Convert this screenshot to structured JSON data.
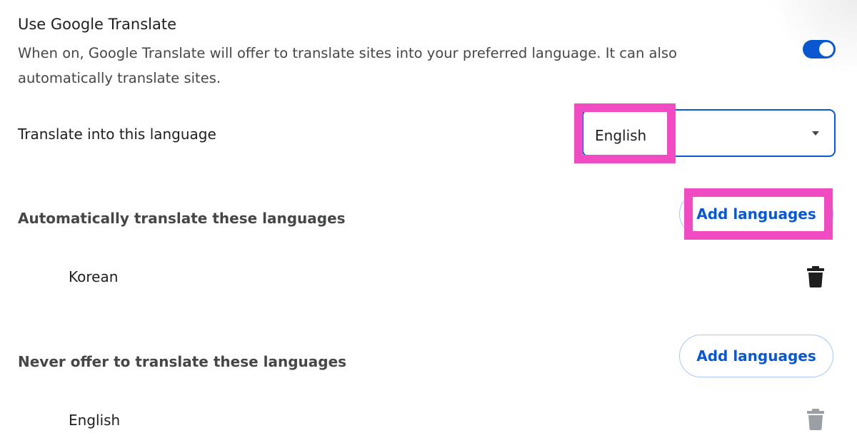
{
  "translate_toggle": {
    "title": "Use Google Translate",
    "description": "When on, Google Translate will offer to translate sites into your preferred language. It can also automatically translate sites.",
    "enabled": true,
    "color": "#0b57d0"
  },
  "target_language": {
    "label": "Translate into this language",
    "selected": "English"
  },
  "auto_translate": {
    "heading": "Automatically translate these languages",
    "add_button_label": "Add languages",
    "items": [
      {
        "label": "Korean",
        "delete_icon": "trash-icon",
        "delete_enabled": true
      }
    ]
  },
  "never_translate": {
    "heading": "Never offer to translate these languages",
    "add_button_label": "Add languages",
    "items": [
      {
        "label": "English",
        "delete_icon": "trash-icon",
        "delete_enabled": false
      }
    ]
  },
  "colors": {
    "accent": "#0b57d0",
    "highlight": "#f14bc3",
    "disabled_icon": "#9aa0a6"
  }
}
